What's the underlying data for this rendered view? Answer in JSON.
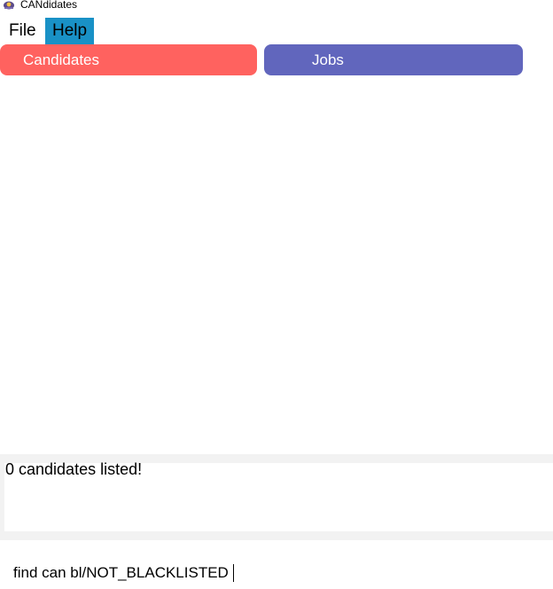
{
  "window": {
    "title": "CANdidates",
    "icon": "app-logo-icon"
  },
  "menubar": {
    "file_label": "File",
    "help_label": "Help"
  },
  "tabs": [
    {
      "label": "Candidates",
      "color": "#ff625f"
    },
    {
      "label": "Jobs",
      "color": "#6166bd"
    }
  ],
  "result_display": {
    "text": "0 candidates listed!"
  },
  "command_box": {
    "value": "find can bl/NOT_BLACKLISTED"
  },
  "colors": {
    "menu_highlight": "#1991c6",
    "panel_border": "#f2f2f2"
  }
}
